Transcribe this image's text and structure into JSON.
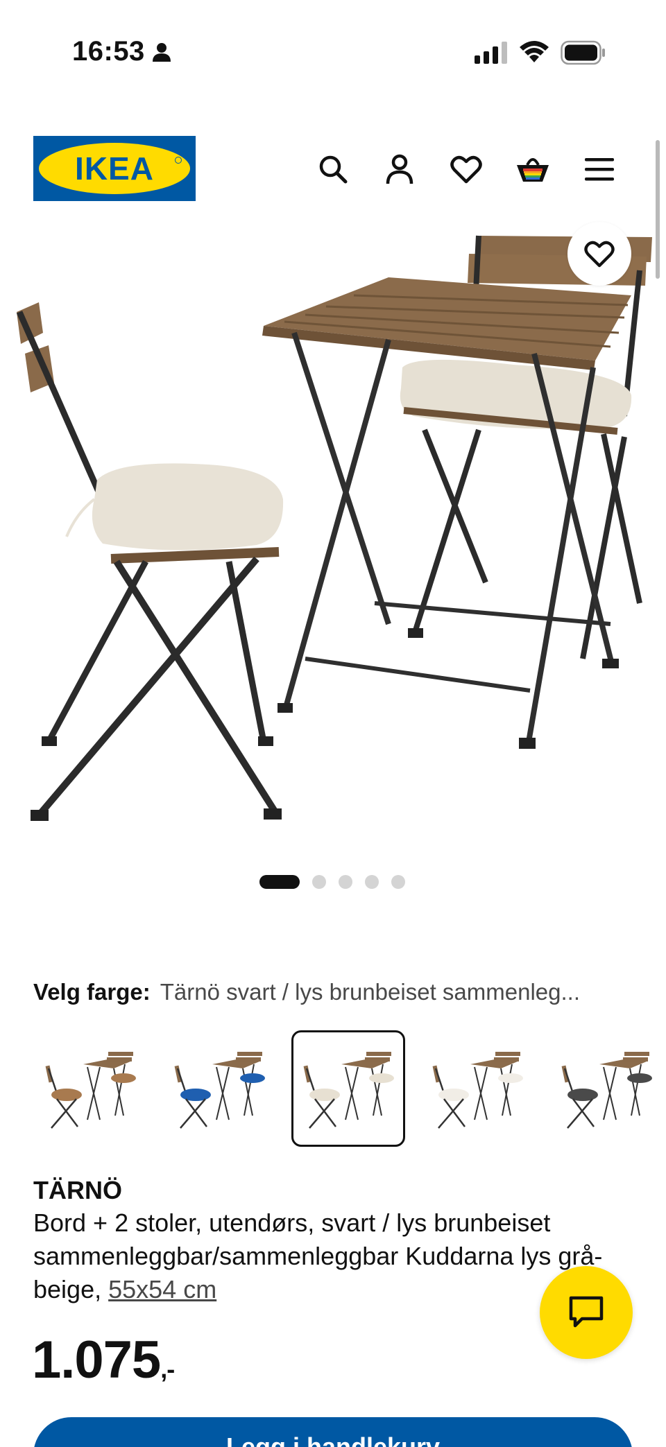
{
  "status_bar": {
    "time": "16:53",
    "icons": [
      "person-icon",
      "cellular-signal-icon",
      "wifi-icon",
      "battery-icon"
    ]
  },
  "header": {
    "logo_text": "IKEA",
    "icons": [
      "search-icon",
      "user-icon",
      "heart-icon",
      "shopping-basket-icon",
      "hamburger-menu-icon"
    ]
  },
  "hero": {
    "image": "product-photo-table-and-two-folding-chairs",
    "favourite_icon": "heart-icon",
    "carousel": {
      "total": 5,
      "active": 1
    }
  },
  "color_select": {
    "label": "Velg farge:",
    "value": "Tärnö svart / lys brunbeiset sammenleg...",
    "options": [
      {
        "cushion_color": "#a87a4f",
        "selected": false
      },
      {
        "cushion_color": "#1f5fb0",
        "selected": false
      },
      {
        "cushion_color": "#e7e0d2",
        "selected": true
      },
      {
        "cushion_color": "#f1ede6",
        "selected": false
      },
      {
        "cushion_color": "#4a4a4a",
        "selected": false
      }
    ]
  },
  "product": {
    "name": "TÄRNÖ",
    "description": "Bord + 2 stoler, utendørs, svart / lys brunbeiset sammenleggbar/sammenleggbar Kuddarna lys grå-beige,",
    "size": "55x54 cm",
    "price": "1.075",
    "price_suffix": ",-"
  },
  "buttons": {
    "chat_icon": "chat-bubble-icon",
    "add_to_cart": "Legg i handlekurv"
  },
  "colors": {
    "ikea_blue": "#0058a3",
    "ikea_yellow": "#ffdb00",
    "text": "#111111",
    "muted_text": "#484848"
  }
}
